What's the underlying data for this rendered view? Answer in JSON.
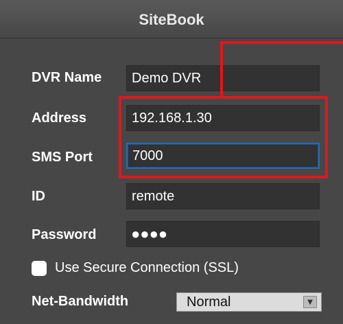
{
  "window": {
    "title": "SiteBook"
  },
  "form": {
    "dvr_name": {
      "label": "DVR Name",
      "value": "Demo DVR"
    },
    "address": {
      "label": "Address",
      "value": "192.168.1.30"
    },
    "sms_port": {
      "label": "SMS Port",
      "value": "7000"
    },
    "id": {
      "label": "ID",
      "value": "remote"
    },
    "password": {
      "label": "Password",
      "masked": "●●●●"
    },
    "ssl": {
      "label": "Use Secure Connection (SSL)",
      "checked": false
    },
    "bandwidth": {
      "label": "Net-Bandwidth",
      "selected": "Normal"
    }
  },
  "colors": {
    "highlight": "#e3161b",
    "focus": "#2c6ab0",
    "background": "#474747"
  },
  "icons": {
    "select_arrow": "chevron-down-icon"
  }
}
